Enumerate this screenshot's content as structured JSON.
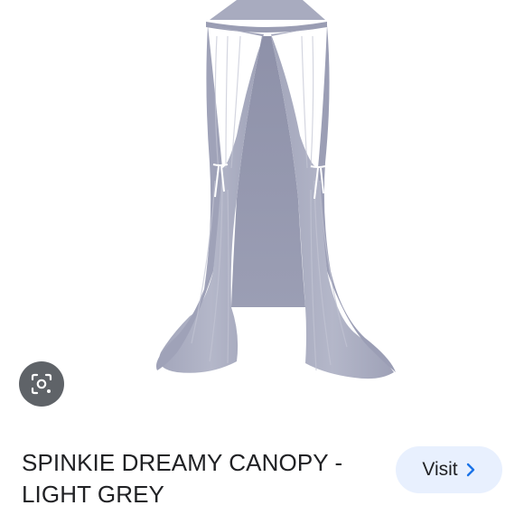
{
  "product": {
    "title": "SPINKIE DREAMY CANOPY - LIGHT GREY",
    "image_icon": "hanging-canopy-image"
  },
  "lens": {
    "icon": "lens-search-icon"
  },
  "visit": {
    "label": "Visit",
    "icon": "chevron-right-icon"
  },
  "colors": {
    "canopy": "#a6a9be",
    "lens_bg": "#5f6368",
    "visit_bg": "#e8f0fe",
    "chevron": "#1a73e8",
    "text": "#202124"
  }
}
